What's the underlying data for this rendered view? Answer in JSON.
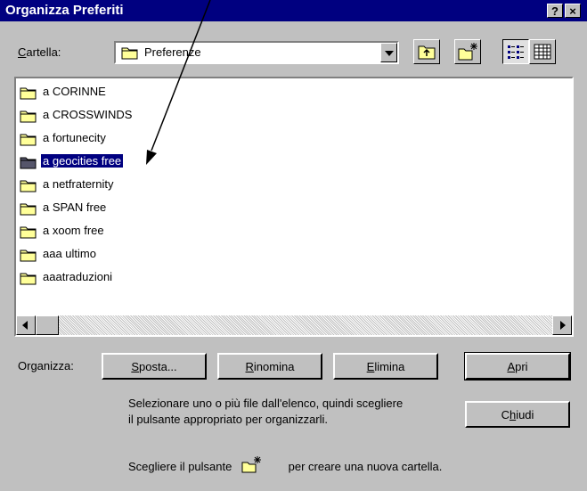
{
  "window": {
    "title": "Organizza Preferiti",
    "help_label": "?",
    "close_label": "×"
  },
  "folder_bar": {
    "label_prefix": "C",
    "label_rest": "artella:",
    "current_folder": "Preferenze"
  },
  "files": [
    {
      "name": "a CORINNE"
    },
    {
      "name": "a CROSSWINDS"
    },
    {
      "name": "a fortunecity"
    },
    {
      "name": "a geocities free",
      "selected": true
    },
    {
      "name": "a netfraternity"
    },
    {
      "name": "a SPAN free"
    },
    {
      "name": "a xoom free"
    },
    {
      "name": "aaa ultimo"
    },
    {
      "name": "aaatraduzioni"
    }
  ],
  "organize": {
    "label": "Organizza:",
    "move": {
      "mnemonic": "S",
      "rest": "posta..."
    },
    "rename": {
      "mnemonic": "R",
      "rest": "inomina"
    },
    "delete": {
      "mnemonic": "E",
      "rest": "limina"
    },
    "open": {
      "mnemonic": "A",
      "rest": "pri"
    },
    "close": {
      "pre": "C",
      "mnemonic": "h",
      "rest": "iudi"
    }
  },
  "hints": {
    "line1": "Selezionare uno o più file dall'elenco, quindi scegliere",
    "line2": "il pulsante appropriato per organizzarli.",
    "new_folder_pre": "Scegliere il pulsante",
    "new_folder_post": "per creare una nuova cartella."
  },
  "colors": {
    "selection": "#000080",
    "titlebar": "#000080",
    "face": "#c0c0c0",
    "folder": "#ffff99"
  },
  "icons": [
    "help-icon",
    "close-icon",
    "folder-icon",
    "up-folder-icon",
    "new-folder-icon",
    "list-view-icon",
    "details-view-icon",
    "scroll-left-icon",
    "scroll-right-icon",
    "pointer-arrow"
  ]
}
